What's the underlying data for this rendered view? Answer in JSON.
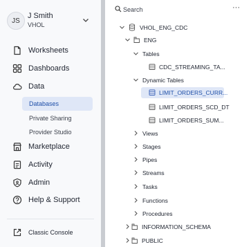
{
  "account": {
    "initials": "JS",
    "name": "J Smith",
    "role": "VHOL"
  },
  "nav": {
    "worksheets": "Worksheets",
    "dashboards": "Dashboards",
    "data": "Data",
    "databases": "Databases",
    "private_sharing": "Private Sharing",
    "provider_studio": "Provider Studio",
    "marketplace": "Marketplace",
    "activity": "Activity",
    "admin": "Admin",
    "help": "Help & Support",
    "classic": "Classic Console"
  },
  "tree": {
    "search_placeholder": "Search",
    "more": "···",
    "database": "VHOL_ENG_CDC",
    "schema": "ENG",
    "tables": "Tables",
    "table_1": "CDC_STREAMING_TA...",
    "dynamic_tables": "Dynamic Tables",
    "dt_1": "LIMIT_ORDERS_CURR...",
    "dt_2": "LIMIT_ORDERS_SCD_DT",
    "dt_3": "LIMIT_ORDERS_SUM...",
    "views": "Views",
    "stages": "Stages",
    "pipes": "Pipes",
    "streams": "Streams",
    "tasks": "Tasks",
    "functions": "Functions",
    "procedures": "Procedures",
    "info_schema": "INFORMATION_SCHEMA",
    "public": "PUBLIC"
  }
}
